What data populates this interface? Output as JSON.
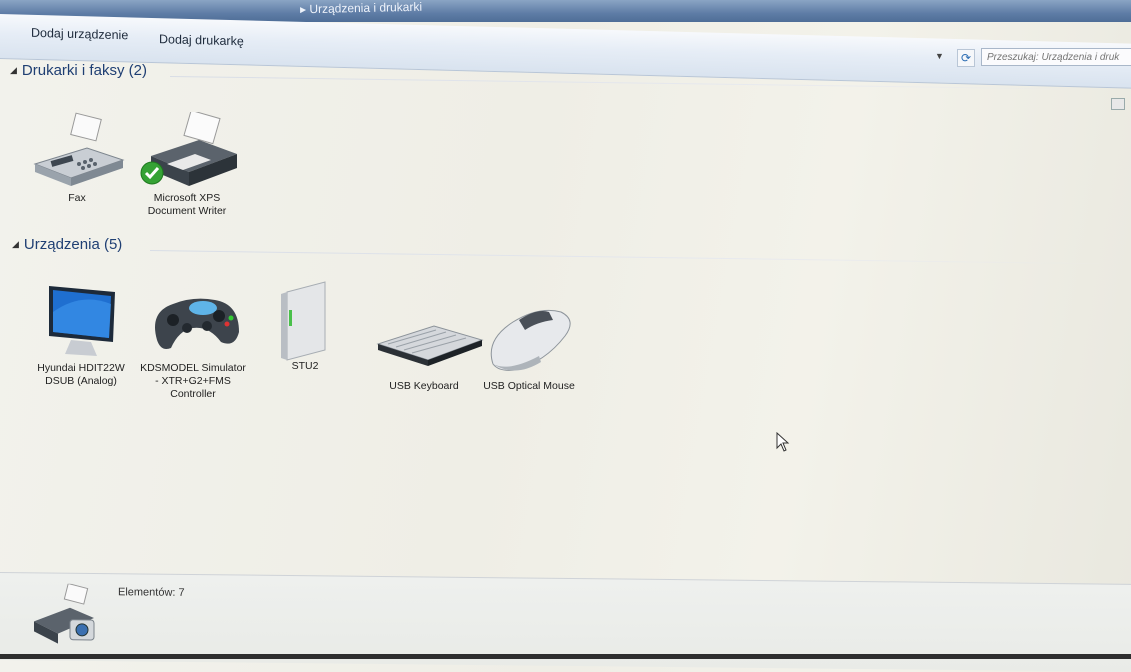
{
  "window": {
    "breadcrumb": "▸ Urządzenia i drukarki"
  },
  "toolbar": {
    "add_device": "Dodaj urządzenie",
    "add_printer": "Dodaj drukarkę"
  },
  "search": {
    "placeholder": "Przeszukaj: Urządzenia i druk"
  },
  "groups": {
    "printers": {
      "title": "Drukarki i faksy (2)"
    },
    "devices": {
      "title": "Urządzenia (5)"
    }
  },
  "printers": [
    {
      "label": "Fax",
      "icon": "fax-icon"
    },
    {
      "label": "Microsoft XPS Document Writer",
      "icon": "printer-icon",
      "default": true
    }
  ],
  "devices": [
    {
      "label": "Hyundai HDIT22W DSUB (Analog)",
      "icon": "monitor-icon"
    },
    {
      "label": "KDSMODEL Simulator - XTR+G2+FMS Controller",
      "icon": "gamepad-icon"
    },
    {
      "label": "STU2",
      "icon": "tower-drive-icon"
    },
    {
      "label": "USB Keyboard",
      "icon": "keyboard-icon"
    },
    {
      "label": "USB Optical Mouse",
      "icon": "mouse-icon"
    }
  ],
  "status": {
    "text": "Elementów: 7"
  },
  "colors": {
    "header": "#1f3f73",
    "toolbar": "#dfe7f2",
    "default_check": "#2e9b2e"
  }
}
